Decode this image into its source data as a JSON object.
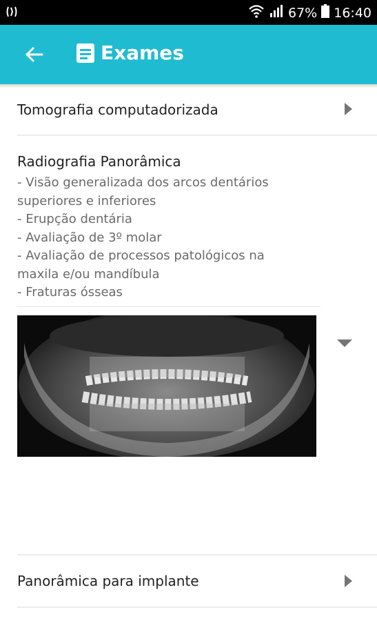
{
  "status_bar": {
    "battery_percent": "67%",
    "time": "16:40"
  },
  "app_bar": {
    "title": "Exames",
    "back_icon": "arrow-left-icon",
    "title_icon": "document-icon"
  },
  "exams": [
    {
      "label": "Tomografia computadorizada",
      "state": "collapsed"
    },
    {
      "label": "Radiografia Panorâmica",
      "state": "expanded",
      "description": [
        "- Visão generalizada dos arcos dentários",
        "superiores e inferiores",
        "- Erupção dentária",
        "- Avaliação de 3º molar",
        "- Avaliação de processos patológicos na",
        "maxila e/ou mandíbula",
        "- Fraturas ósseas"
      ]
    },
    {
      "label": "Panorâmica para implante",
      "state": "collapsed"
    }
  ],
  "colors": {
    "app_bar": "#1fbcd1",
    "status_bar": "#000000",
    "text": "#222222",
    "secondary_text": "#6a6a6a"
  }
}
